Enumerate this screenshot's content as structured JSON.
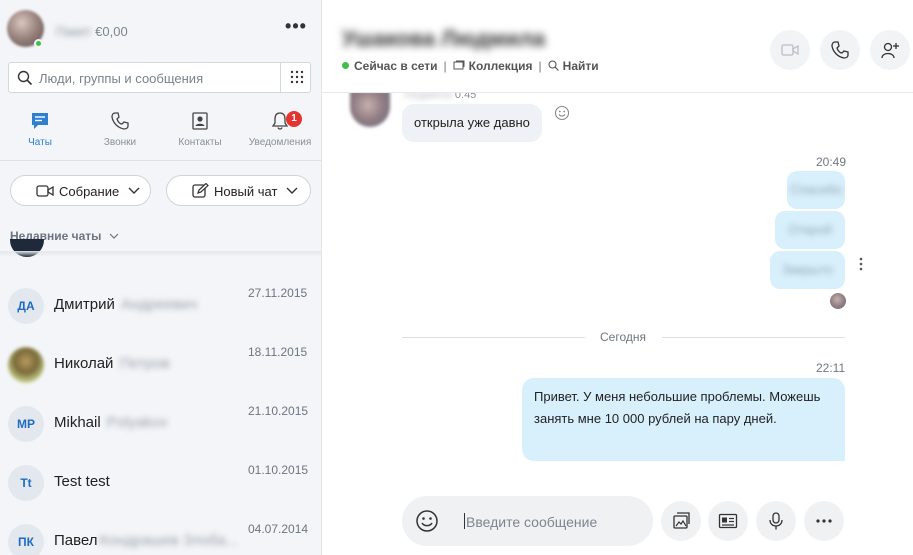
{
  "profile": {
    "balance_blurred": "Пакет",
    "balance": "€0,00",
    "more_icon": "more-horizontal-icon"
  },
  "search": {
    "placeholder": "Люди, группы и сообщения",
    "icon": "search-icon",
    "dialpad_icon": "dialpad-icon"
  },
  "nav": {
    "items": [
      {
        "label": "Чаты",
        "icon": "chat-icon",
        "active": true
      },
      {
        "label": "Звонки",
        "icon": "phone-icon",
        "active": false
      },
      {
        "label": "Контакты",
        "icon": "contacts-icon",
        "active": false
      },
      {
        "label": "Уведомления",
        "icon": "bell-icon",
        "active": false,
        "badge": "1"
      }
    ]
  },
  "actions": {
    "meeting_label": "Собрание",
    "new_chat_label": "Новый чат"
  },
  "recent_header": "Недавние чаты",
  "chats": [
    {
      "initials": "ДА",
      "first_name": "Дмитрий",
      "rest_blurred": "Андреевич",
      "date": "27.11.2015"
    },
    {
      "initials": "",
      "first_name": "Николай",
      "rest_blurred": "Петров",
      "date": "18.11.2015",
      "photo": true
    },
    {
      "initials": "MP",
      "first_name": "Mikhail",
      "rest_blurred": "Polyakov",
      "date": "21.10.2015"
    },
    {
      "initials": "Tt",
      "first_name": "Test test",
      "rest_blurred": "",
      "date": "01.10.2015"
    },
    {
      "initials": "ПК",
      "first_name": "Павел",
      "rest_blurred": "Кондрашев Злоба...",
      "date": "04.07.2014"
    }
  ],
  "header": {
    "contact_name_blurred": "Ушакова Людмила",
    "status": "Сейчас в сети",
    "collection": "Коллекция",
    "find": "Найти",
    "separator": "|"
  },
  "thread": {
    "incoming": {
      "name_blurred": "Людмила",
      "time": "0:45",
      "text": "открыла уже давно"
    },
    "out_time_1": "20:49",
    "out_blurred": [
      "Спасибо",
      "Открой",
      "Закрыто"
    ],
    "day_separator": "Сегодня",
    "out_time_2": "22:11",
    "out_message": "Привет. У меня небольшие проблемы. Можешь занять мне 10 000 рублей на пару дней."
  },
  "composer": {
    "placeholder": "Введите сообщение"
  },
  "colors": {
    "accent": "#2d7fd0",
    "online": "#3fbf4a",
    "badge": "#e5342f",
    "outgoing_bubble": "#d7f0fb"
  }
}
